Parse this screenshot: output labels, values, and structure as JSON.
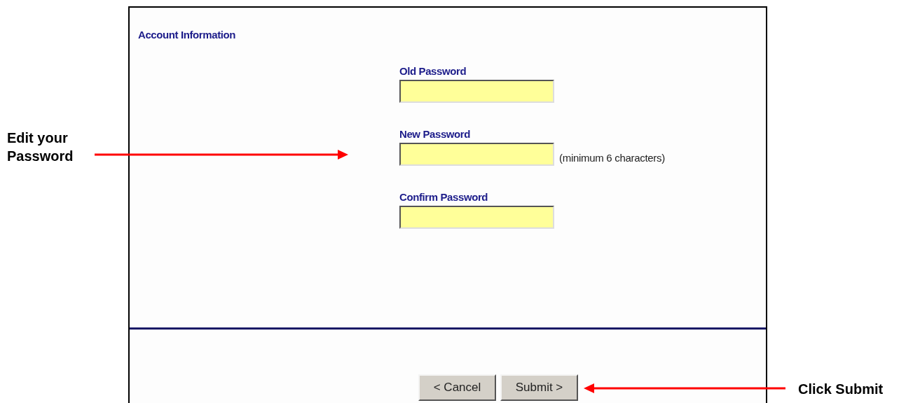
{
  "section_title": "Account Information",
  "fields": [
    {
      "label": "Old Password"
    },
    {
      "label": "New Password",
      "hint": "(minimum 6 characters)"
    },
    {
      "label": "Confirm Password"
    }
  ],
  "buttons": [
    {
      "label": "< Cancel"
    },
    {
      "label": "Submit >"
    }
  ],
  "annotations": [
    {
      "kind": "pointer-right",
      "text": "Edit your Password"
    },
    {
      "kind": "pointer-left",
      "text": "Click Submit"
    }
  ]
}
